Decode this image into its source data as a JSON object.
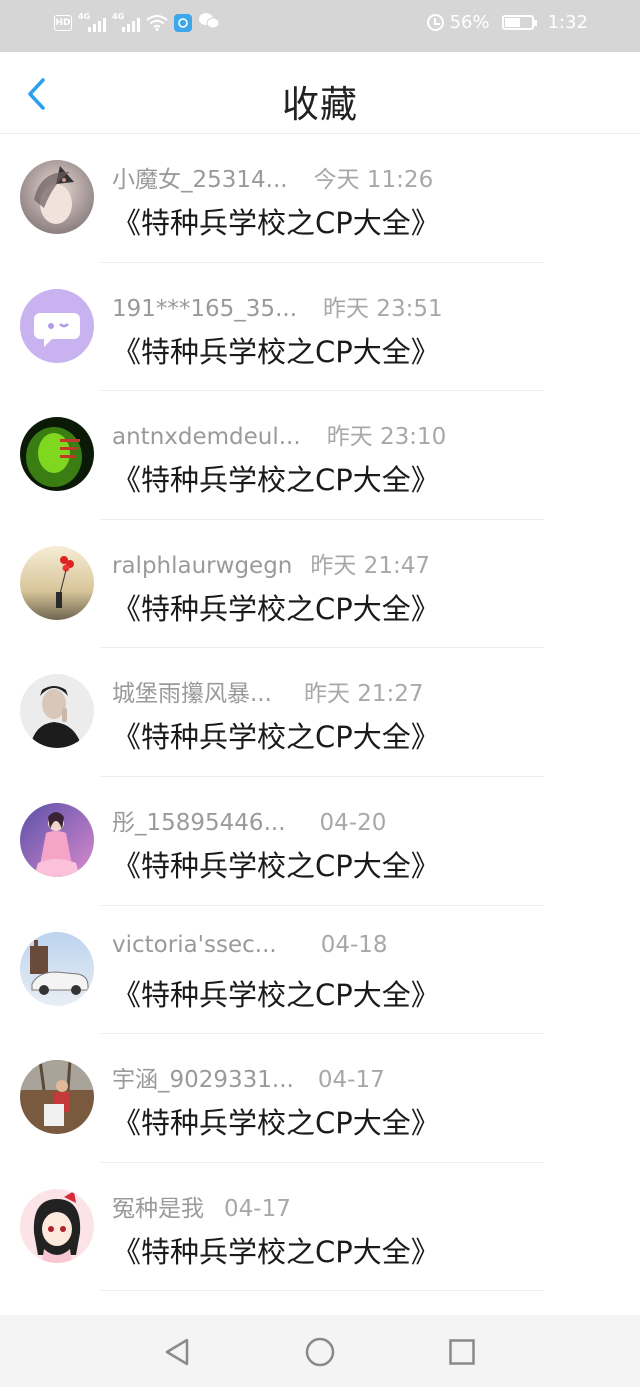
{
  "status_bar": {
    "hd": "HD",
    "network1": "4G",
    "network2": "4G",
    "battery_percent": "56%",
    "time": "1:32"
  },
  "header": {
    "title": "收藏",
    "back_icon": "chevron-left-icon",
    "accent_color": "#2aa0f0"
  },
  "items": [
    {
      "name": "小魔女_25314...",
      "time": "今天 11:26",
      "title": "《特种兵学校之CP大全》"
    },
    {
      "name": "191***165_35...",
      "time": "昨天 23:51",
      "title": "《特种兵学校之CP大全》"
    },
    {
      "name": "antnxdemdeul...",
      "time": "昨天 23:10",
      "title": "《特种兵学校之CP大全》"
    },
    {
      "name": "ralphlaurwgegn",
      "time": "昨天 21:47",
      "title": "《特种兵学校之CP大全》"
    },
    {
      "name": "城堡雨攥风暴...",
      "time": "昨天 21:27",
      "title": "《特种兵学校之CP大全》"
    },
    {
      "name": "彤_15895446...",
      "time": "04-20",
      "title": "《特种兵学校之CP大全》"
    },
    {
      "name": "victoria'ssec...",
      "time": "04-18",
      "title": "《特种兵学校之CP大全》"
    },
    {
      "name": "宇涵_9029331...",
      "time": "04-17",
      "title": "《特种兵学校之CP大全》"
    },
    {
      "name": "冤种是我",
      "time": "04-17",
      "title": "《特种兵学校之CP大全》"
    }
  ],
  "bottom_nav": {
    "back_icon": "triangle-back-icon",
    "home_icon": "circle-home-icon",
    "recents_icon": "square-recents-icon"
  }
}
